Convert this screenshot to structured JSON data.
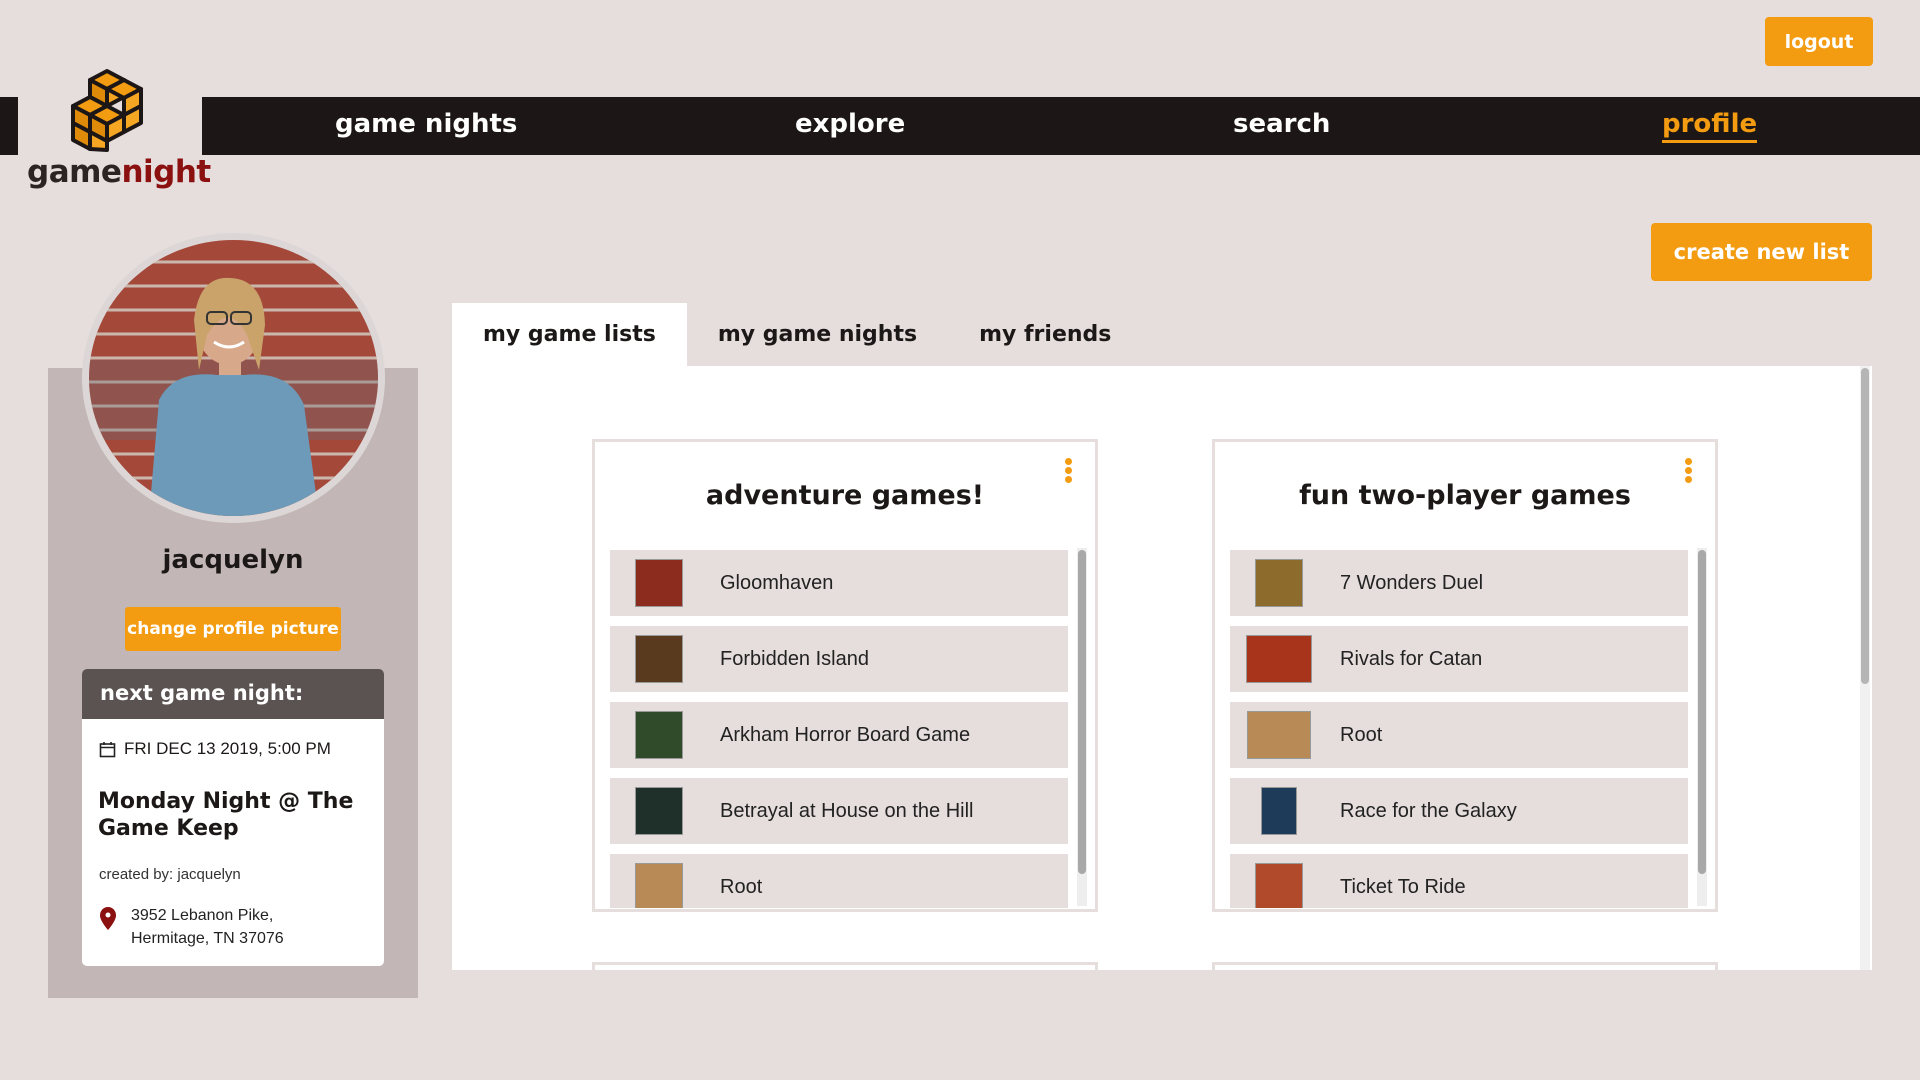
{
  "app": {
    "brand_word1": "game",
    "brand_word2": "night",
    "logout_label": "logout"
  },
  "nav": {
    "items": [
      {
        "label": "game nights"
      },
      {
        "label": "explore"
      },
      {
        "label": "search"
      },
      {
        "label": "profile"
      }
    ],
    "active": "profile"
  },
  "profile": {
    "username": "jacquelyn",
    "change_picture_label": "change profile picture",
    "next_game_night": {
      "header": "next game night:",
      "date": "FRI DEC 13 2019, 5:00 PM",
      "title": "Monday Night @ The Game Keep",
      "created_by": "created by: jacquelyn",
      "address_line1": "3952 Lebanon Pike,",
      "address_line2": "Hermitage, TN 37076"
    }
  },
  "create_list_label": "create new list",
  "tabs": [
    {
      "label": "my game lists"
    },
    {
      "label": "my game nights"
    },
    {
      "label": "my friends"
    }
  ],
  "active_tab": "my game lists",
  "lists": [
    {
      "title": "adventure games!",
      "games": [
        {
          "name": "Gloomhaven",
          "color": "#8b2c1f"
        },
        {
          "name": "Forbidden Island",
          "color": "#5a3a1e"
        },
        {
          "name": "Arkham Horror Board Game",
          "color": "#2f4b2a"
        },
        {
          "name": "Betrayal at House on the Hill",
          "color": "#1f2f2a"
        },
        {
          "name": "Root",
          "color": "#b88a55"
        }
      ]
    },
    {
      "title": "fun two-player games",
      "games": [
        {
          "name": "7 Wonders Duel",
          "color": "#8d6b2d"
        },
        {
          "name": "Rivals for Catan",
          "color": "#a8341c"
        },
        {
          "name": "Root",
          "color": "#b88a55"
        },
        {
          "name": "Race for the Galaxy",
          "color": "#1f3b5a"
        },
        {
          "name": "Ticket To Ride",
          "color": "#b04a2a"
        }
      ]
    }
  ],
  "colors": {
    "accent": "#f39c12",
    "nav_bg": "#1c1716",
    "brand_dark_red": "#8b1010",
    "page_bg": "#e6dedd"
  }
}
